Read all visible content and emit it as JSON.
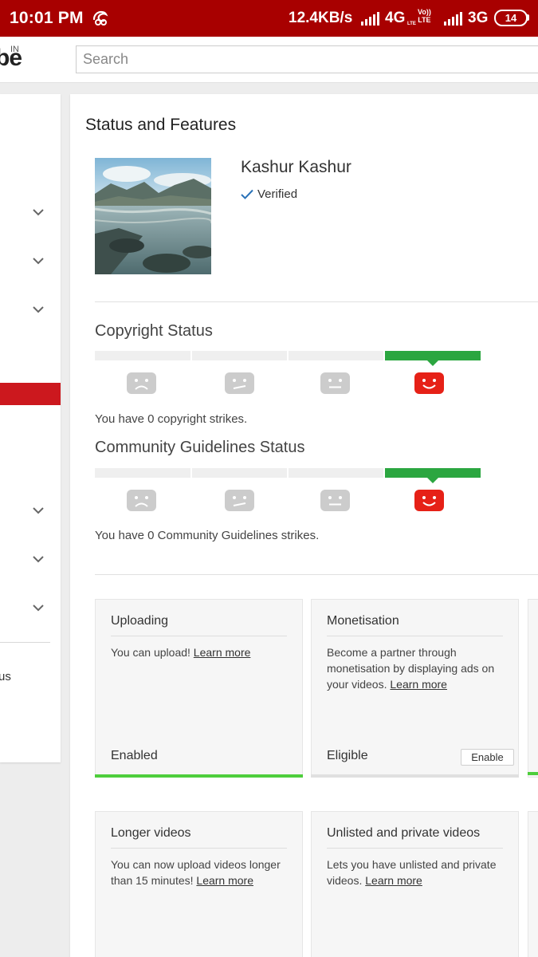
{
  "status_bar": {
    "time": "10:01 PM",
    "net_speed": "12.4KB/s",
    "network1": "4G",
    "network1_tag": "LTE",
    "volte_top": "Vo))",
    "volte_bottom": "LTE",
    "network2": "3G",
    "battery": "14",
    "icons": [
      "uc-browser-icon",
      "signal-icon",
      "battery-icon"
    ]
  },
  "header": {
    "logo_text": "be",
    "logo_region": "IN",
    "search_placeholder": "Search"
  },
  "sidebar": {
    "partial_label": "us",
    "accent": "#cc181e"
  },
  "main": {
    "title": "Status and Features",
    "channel_name": "Kashur Kashur",
    "verified_label": "Verified"
  },
  "copyright": {
    "title": "Copyright Status",
    "strike_text": "You have 0 copyright strikes.",
    "active_level": 4
  },
  "community": {
    "title": "Community Guidelines Status",
    "strike_text": "You have 0 Community Guidelines strikes.",
    "active_level": 4
  },
  "cards": {
    "uploading": {
      "title": "Uploading",
      "desc": "You can upload! ",
      "link": "Learn more",
      "status": "Enabled"
    },
    "monetisation": {
      "title": "Monetisation",
      "desc": "Become a partner through monetisation by displaying ads on your videos. ",
      "link": "Learn more",
      "status": "Eligible",
      "button": "Enable"
    },
    "longer_videos": {
      "title": "Longer videos",
      "desc": "You can now upload videos longer than 15 minutes! ",
      "link": "Learn more"
    },
    "unlisted": {
      "title": "Unlisted and private videos",
      "desc": "Lets you have unlisted and private videos. ",
      "link": "Learn more"
    }
  },
  "colors": {
    "status_bar": "#a80000",
    "good": "#2ba640",
    "face_active": "#e62117",
    "face_inactive": "#cccccc"
  }
}
